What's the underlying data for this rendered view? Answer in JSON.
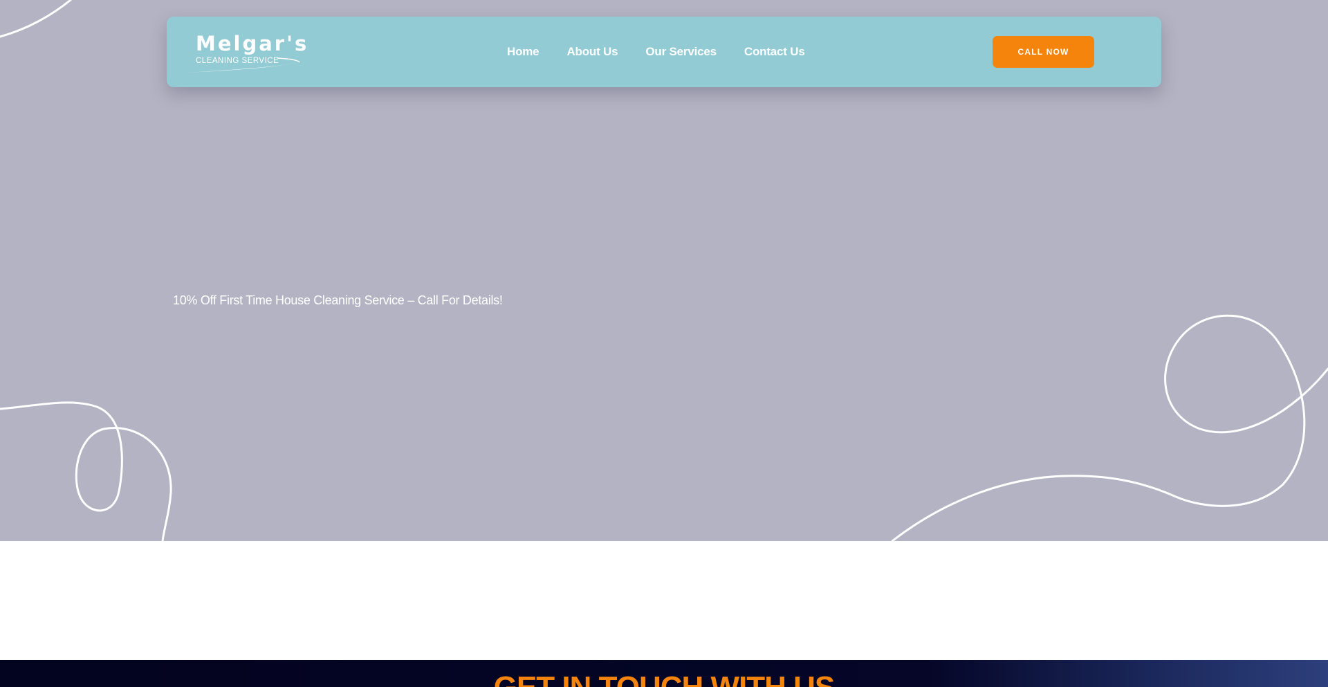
{
  "brand": {
    "name": "Melgar's",
    "tagline": "CLEANING SERVICE"
  },
  "nav": {
    "items": [
      "Home",
      "About Us",
      "Our Services",
      "Contact Us"
    ],
    "cta_label": "CALL NOW"
  },
  "hero": {
    "promo_text": "10% Off First Time House Cleaning Service – Call For Details!"
  },
  "footer": {
    "title": "GET IN TOUCH WITH US"
  },
  "colors": {
    "hero_bg": "#b3b3c3",
    "navbar_bg": "#92cbd4",
    "accent": "#f5840c",
    "footer_bg": "#03041f"
  }
}
